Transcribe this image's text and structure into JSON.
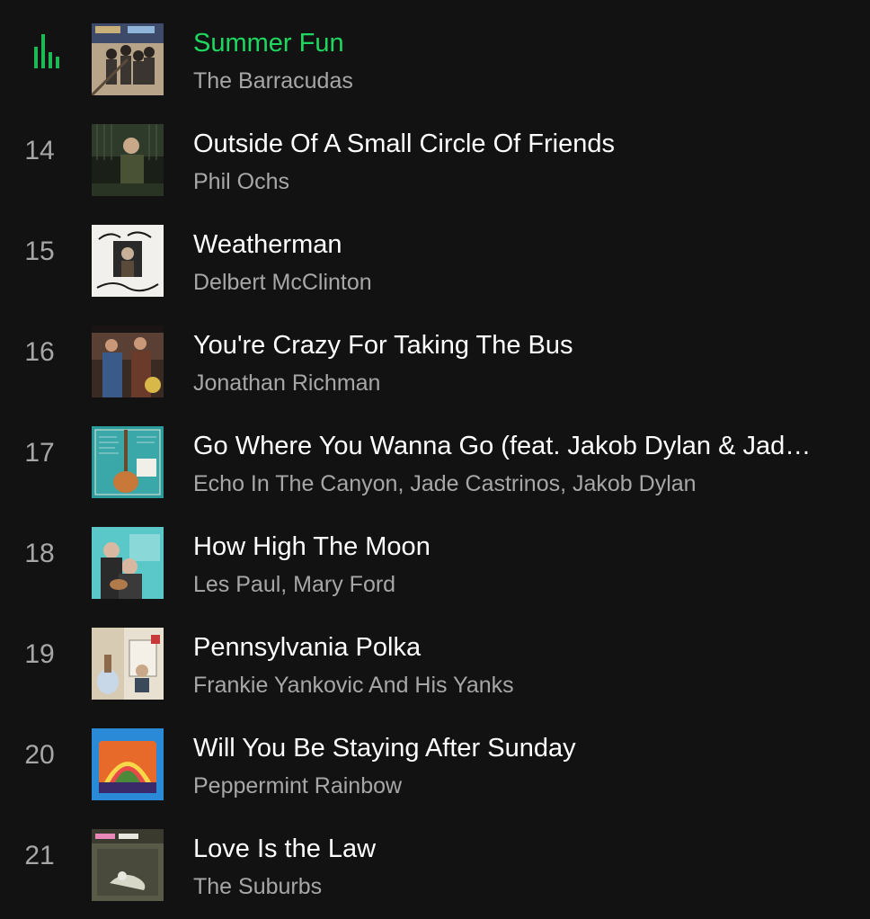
{
  "colors": {
    "background": "#121212",
    "accent": "#1ed760",
    "text_primary": "#ffffff",
    "text_secondary": "#a7a7a7"
  },
  "tracks": [
    {
      "index": "",
      "playing": true,
      "icon": "equalizer-icon",
      "title": "Summer Fun",
      "artist": "The Barracudas"
    },
    {
      "index": "14",
      "playing": false,
      "title": "Outside Of A Small Circle Of Friends",
      "artist": "Phil Ochs"
    },
    {
      "index": "15",
      "playing": false,
      "title": "Weatherman",
      "artist": "Delbert McClinton"
    },
    {
      "index": "16",
      "playing": false,
      "title": "You're Crazy For Taking The Bus",
      "artist": "Jonathan Richman"
    },
    {
      "index": "17",
      "playing": false,
      "title": "Go Where You Wanna Go (feat. Jakob Dylan & Jad…",
      "artist": "Echo In The Canyon, Jade Castrinos, Jakob Dylan"
    },
    {
      "index": "18",
      "playing": false,
      "title": "How High The Moon",
      "artist": "Les Paul, Mary Ford"
    },
    {
      "index": "19",
      "playing": false,
      "title": "Pennsylvania Polka",
      "artist": "Frankie Yankovic And His Yanks"
    },
    {
      "index": "20",
      "playing": false,
      "title": "Will You Be Staying After Sunday",
      "artist": "Peppermint Rainbow"
    },
    {
      "index": "21",
      "playing": false,
      "title": "Love Is the Law",
      "artist": "The Suburbs"
    }
  ]
}
